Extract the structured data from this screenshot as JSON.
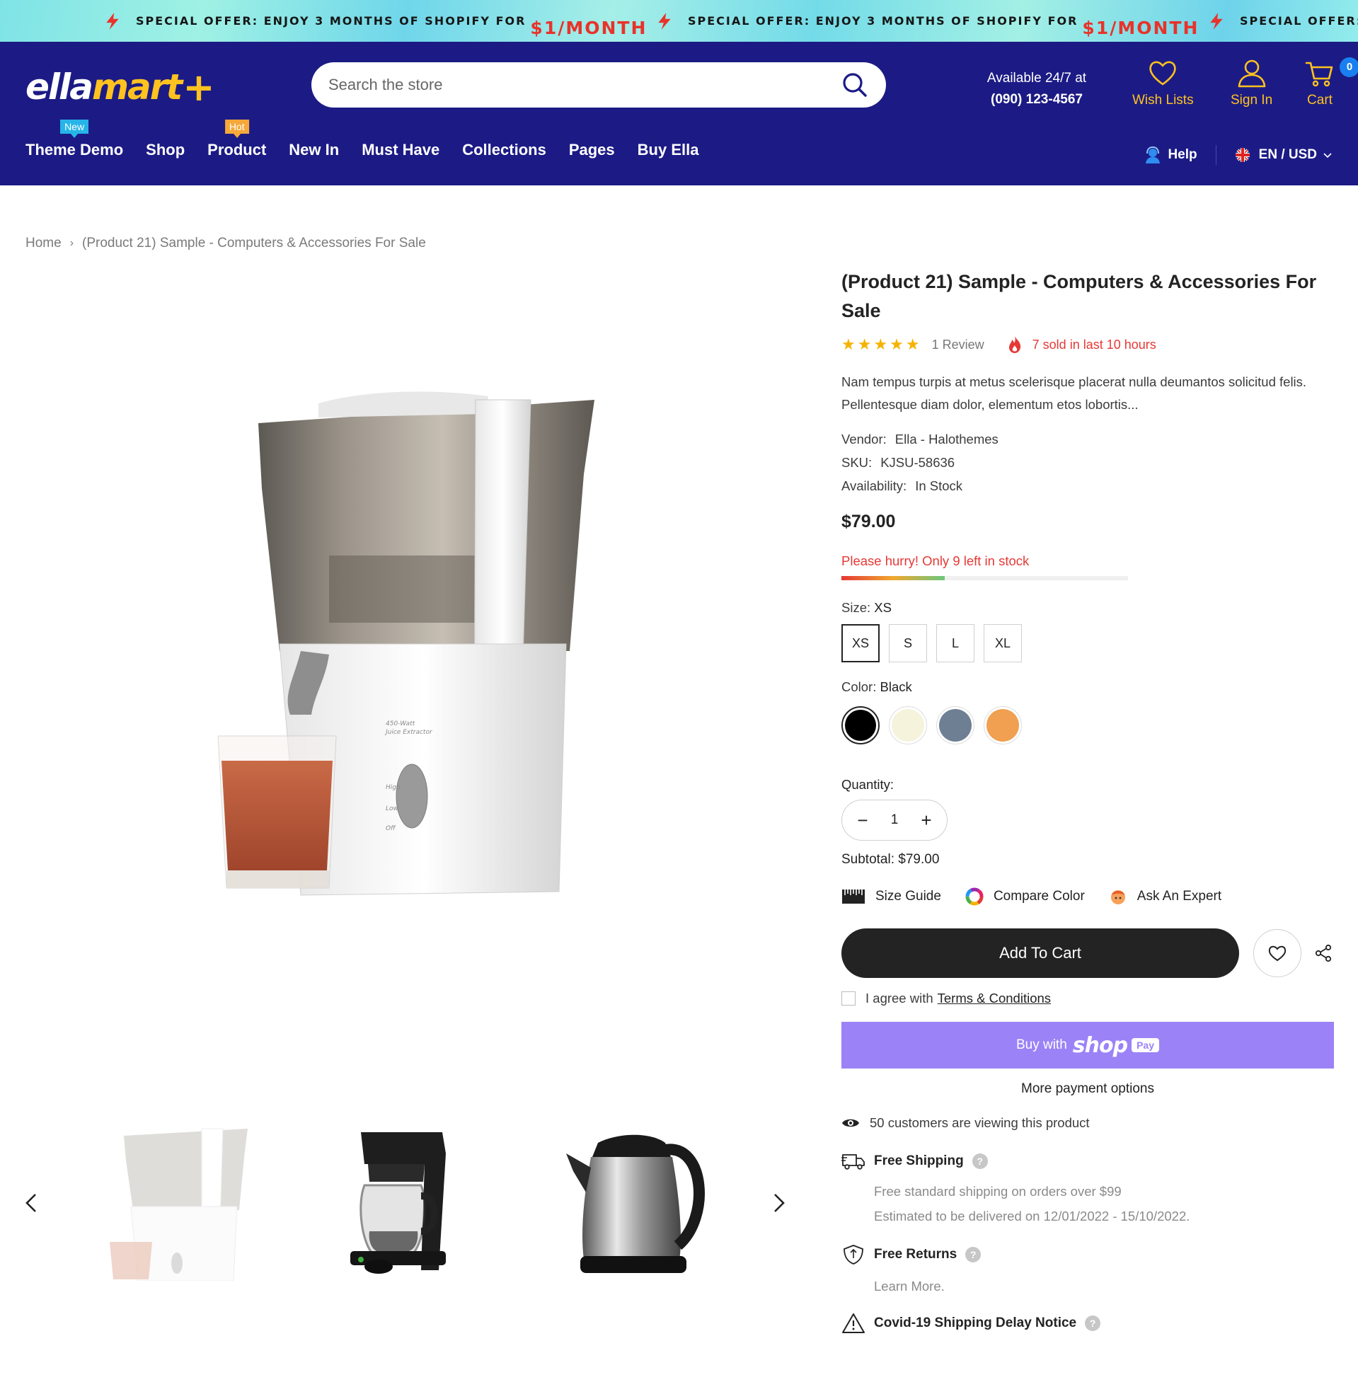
{
  "announcement": {
    "text": "SPECIAL OFFER: ENJOY 3 MONTHS OF SHOPIFY FOR",
    "price": "$1/MONTH"
  },
  "header": {
    "logo": {
      "part1": "ella",
      "part2": "mart",
      "part3": "+"
    },
    "search": {
      "placeholder": "Search the store"
    },
    "contact": {
      "line1": "Available 24/7 at",
      "line2": "(090) 123-4567"
    },
    "wishlist": "Wish Lists",
    "signin": "Sign In",
    "cart": {
      "label": "Cart",
      "count": "0"
    }
  },
  "nav": {
    "items": [
      {
        "label": "Theme Demo",
        "badge": "New"
      },
      {
        "label": "Shop"
      },
      {
        "label": "Product",
        "badge": "Hot"
      },
      {
        "label": "New In"
      },
      {
        "label": "Must Have"
      },
      {
        "label": "Collections"
      },
      {
        "label": "Pages"
      },
      {
        "label": "Buy Ella"
      }
    ],
    "help": "Help",
    "language": "EN / USD"
  },
  "breadcrumb": {
    "home": "Home",
    "current": "(Product 21) Sample - Computers & Accessories For Sale"
  },
  "product": {
    "title": "(Product 21) Sample - Computers & Accessories For Sale",
    "stars": "★★★★★",
    "reviews": "1 Review",
    "sold": "7 sold in last 10 hours",
    "description": "Nam tempus turpis at metus scelerisque placerat nulla deumantos solicitud felis. Pellentesque diam dolor, elementum etos lobortis...",
    "vendor_label": "Vendor:",
    "vendor": "Ella - Halothemes",
    "sku_label": "SKU:",
    "sku": "KJSU-58636",
    "availability_label": "Availability:",
    "availability": "In Stock",
    "price": "$79.00",
    "hurry": "Please hurry! Only 9 left in stock",
    "stock_fraction": 0.36,
    "size_label": "Size:",
    "size_selected": "XS",
    "sizes": [
      "XS",
      "S",
      "L",
      "XL"
    ],
    "color_label": "Color:",
    "color_selected": "Black",
    "colors": [
      "#000000",
      "#f5f3dc",
      "#6e7f93",
      "#f0a050"
    ],
    "quantity_label": "Quantity:",
    "quantity": "1",
    "subtotal_label": "Subtotal:",
    "subtotal": "$79.00",
    "tools": {
      "size_guide": "Size Guide",
      "compare_color": "Compare Color",
      "ask_expert": "Ask An Expert"
    },
    "add_to_cart": "Add To Cart",
    "agree_text": "I agree with",
    "terms": "Terms & Conditions",
    "shoppay": {
      "buy_with": "Buy with",
      "brand": "shop",
      "pay": "Pay"
    },
    "more_payment": "More payment options",
    "viewing": "50 customers are viewing this product",
    "shipping": {
      "title": "Free Shipping",
      "line1": "Free standard shipping on orders over $99",
      "line2": "Estimated to be delivered on 12/01/2022 - 15/10/2022."
    },
    "returns": {
      "title": "Free Returns",
      "line1": "Learn More."
    },
    "covid": {
      "title": "Covid-19 Shipping Delay Notice"
    }
  },
  "colors": {
    "header_bg": "#1c1b85",
    "accent": "#ffc21f",
    "danger": "#e53935",
    "shoppay": "#9b82f7"
  }
}
